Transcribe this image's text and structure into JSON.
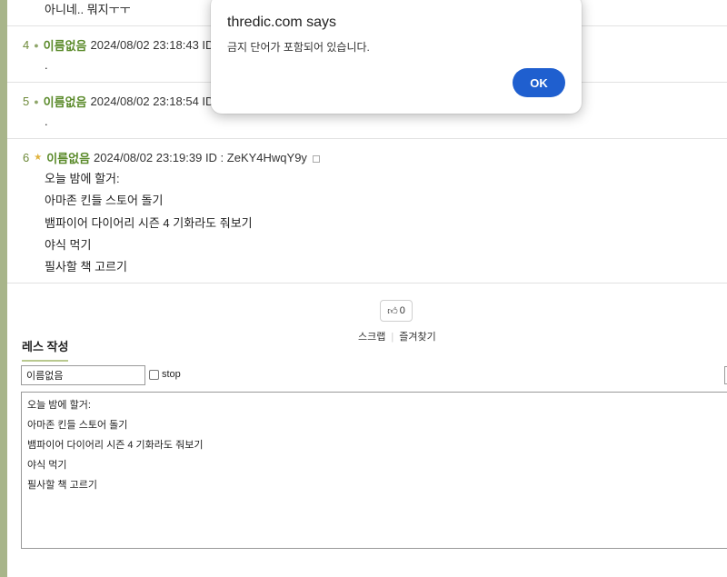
{
  "thread": {
    "post_top_partial": {
      "line": "아니네.. 뭐지ㅜㅜ"
    },
    "posts": [
      {
        "num": "4",
        "author": "이름없음",
        "date": "2024/08/02 23:18:43 ID",
        "lines": [
          "."
        ]
      },
      {
        "num": "5",
        "author": "이름없음",
        "date": "2024/08/02 23:18:54 ID",
        "lines": [
          "."
        ]
      },
      {
        "num": "6",
        "author": "이름없음",
        "date": "2024/08/02 23:19:39 ID : ZeKY4HwqY9y",
        "lines": [
          "오늘 밤에 할거:",
          "아마존 킨들 스토어 돌기",
          "뱀파이어 다이어리 시즌 4 기화라도 줘보기",
          "야식 먹기",
          "필사할 책 고르기"
        ]
      }
    ]
  },
  "actions": {
    "like_count": "0",
    "scrap": "스크랩",
    "favorite": "즐겨찾기"
  },
  "reply_form": {
    "title": "레스 작성",
    "name_value": "이름없음",
    "stop_label": "stop",
    "stop_checked": false,
    "text_lines": [
      "오늘 밤에 할거:",
      "아마존 킨들 스토어 돌기",
      "뱀파이어 다이어리 시즌 4 기화라도 줘보기",
      "야식 먹기",
      "필사할 책 고르기"
    ]
  },
  "dialog": {
    "title": "thredic.com says",
    "message": "금지 단어가 포함되어 있습니다.",
    "ok_label": "OK"
  },
  "colors": {
    "accent_green": "#5a8a2a",
    "left_bar": "#a8b58a",
    "ok_button": "#1f5fcf"
  }
}
